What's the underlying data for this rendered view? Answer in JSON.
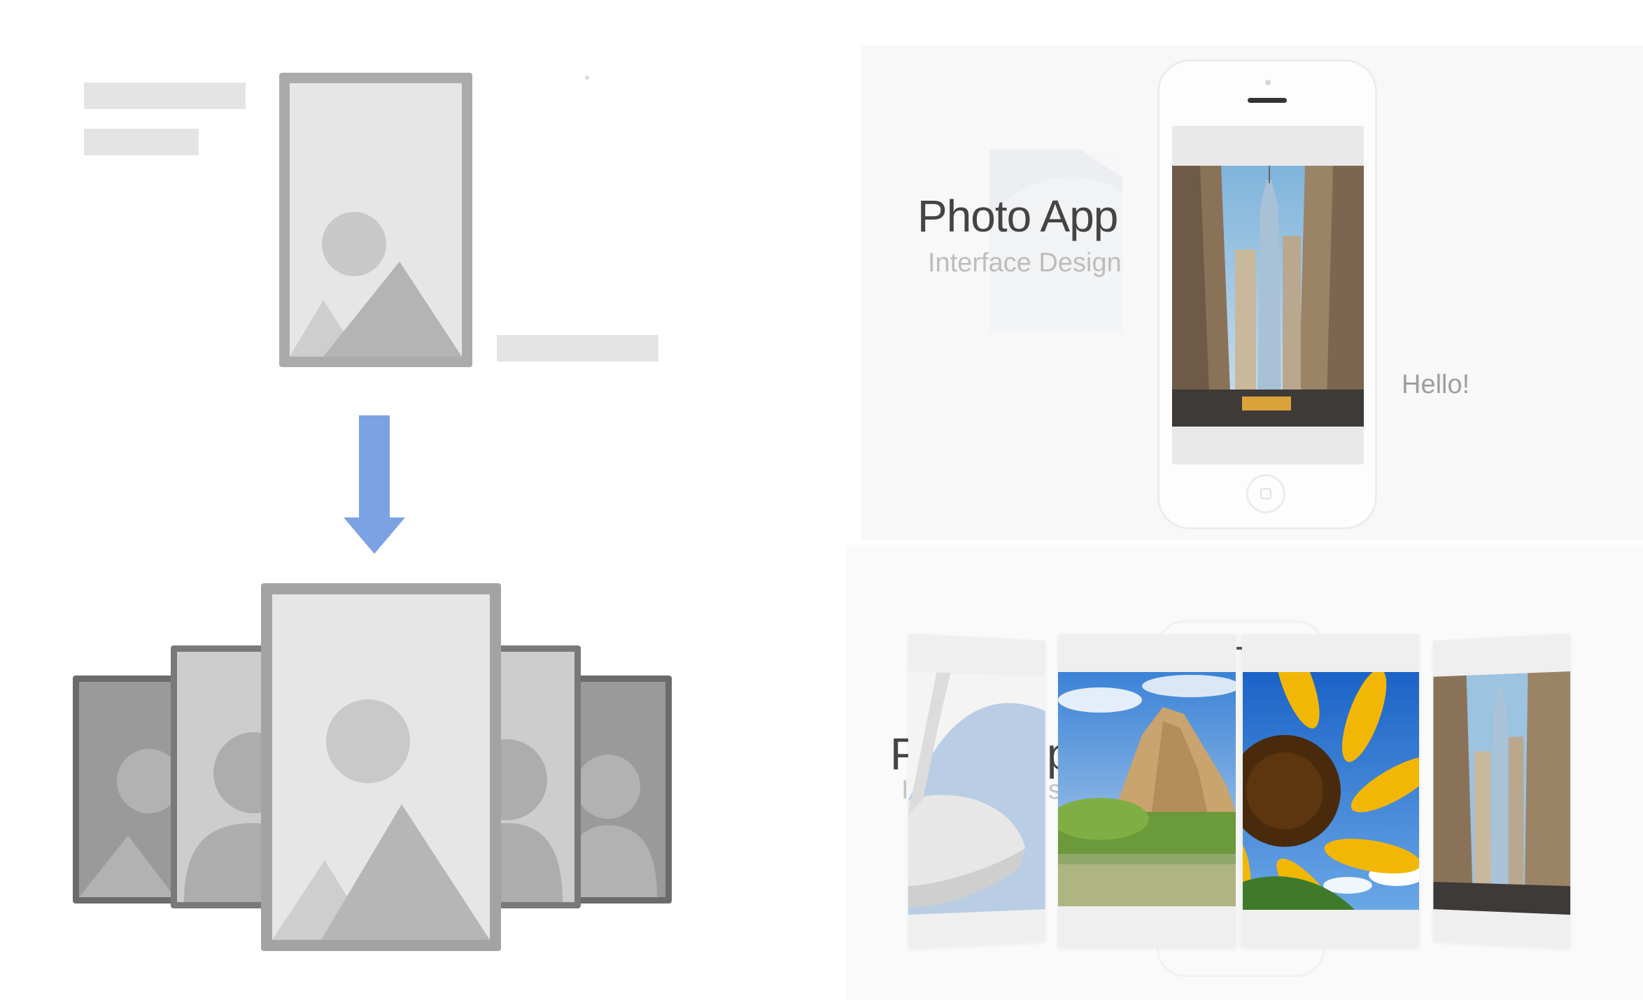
{
  "top_panel": {
    "title": "Photo App",
    "subtitle": "Interface Design",
    "greeting": "Hello!"
  },
  "bottom_panel": {
    "title_fragment": "P",
    "title_fragment_2": "p",
    "subtitle_fragment": "I",
    "subtitle_fragment_2": "s"
  },
  "colors": {
    "arrow": "#7ba3e3",
    "placeholder_bar": "#e4e4e4",
    "frame_border": "#ababab",
    "frame_fill": "#e6e6e6",
    "panel_bg": "#f8f8f8"
  },
  "icons": [
    "image-placeholder-icon",
    "person-placeholder-icon",
    "down-arrow-icon",
    "home-button-icon"
  ],
  "carousel": {
    "cards": [
      "architecture-photo",
      "rock-landscape-photo",
      "sunflower-photo",
      "city-tower-photo"
    ],
    "active_index": 1
  }
}
